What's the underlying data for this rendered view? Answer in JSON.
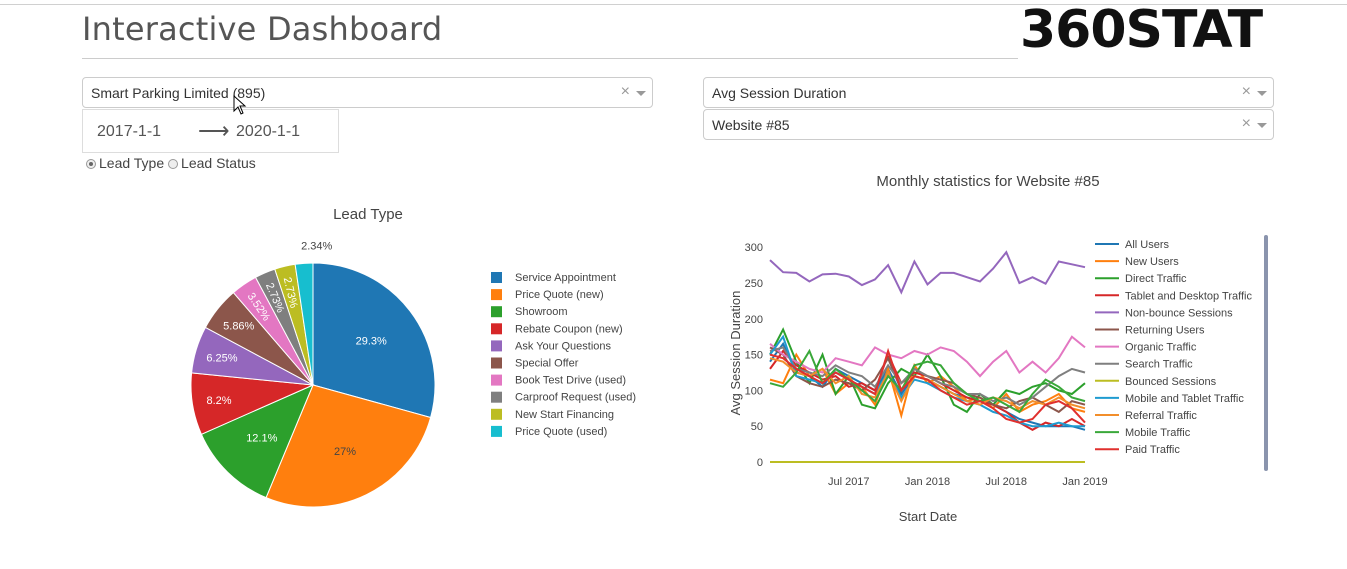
{
  "header": {
    "title": "Interactive Dashboard",
    "logo": "360STAT"
  },
  "filters": {
    "company": {
      "value": "Smart Parking Limited (895)",
      "clear": "×"
    },
    "date_range": {
      "start": "2017-1-1",
      "arrow": "⟶",
      "end": "2020-1-1"
    },
    "radio": [
      {
        "label": "Lead Type",
        "selected": true
      },
      {
        "label": "Lead Status",
        "selected": false
      }
    ],
    "metric": {
      "value": "Avg Session Duration",
      "clear": "×"
    },
    "website": {
      "value": "Website #85",
      "clear": "×"
    }
  },
  "chart_data": [
    {
      "type": "pie",
      "title": "Lead Type",
      "legend_position": "right",
      "slices": [
        {
          "label": "Service Appointment",
          "value": 29.3,
          "display": "29.3%",
          "color": "#1f77b4"
        },
        {
          "label": "Price Quote (new)",
          "value": 27,
          "display": "27%",
          "color": "#ff7f0e"
        },
        {
          "label": "Showroom",
          "value": 12.1,
          "display": "12.1%",
          "color": "#2ca02c"
        },
        {
          "label": "Rebate Coupon (new)",
          "value": 8.2,
          "display": "8.2%",
          "color": "#d62728"
        },
        {
          "label": "Ask Your Questions",
          "value": 6.25,
          "display": "6.25%",
          "color": "#9467bd"
        },
        {
          "label": "Special Offer",
          "value": 5.86,
          "display": "5.86%",
          "color": "#8c564b"
        },
        {
          "label": "Book Test Drive (used)",
          "value": 3.52,
          "display": "3.52%",
          "color": "#e377c2"
        },
        {
          "label": "Carproof Request (used)",
          "value": 2.73,
          "display": "2.73%",
          "color": "#7f7f7f"
        },
        {
          "label": "New Start Financing",
          "value": 2.73,
          "display": "2.73%",
          "color": "#bcbd22"
        },
        {
          "label": "Price Quote (used)",
          "value": 2.34,
          "display": "2.34%",
          "color": "#17becf"
        }
      ]
    },
    {
      "type": "line",
      "title": "Monthly statistics for Website #85",
      "xlabel": "Start Date",
      "ylabel": "Avg Session Duration",
      "ylim": [
        0,
        310
      ],
      "yticks": [
        "0",
        "50",
        "100",
        "150",
        "200",
        "250",
        "300"
      ],
      "xticks": [
        "Jul 2017",
        "Jan 2018",
        "Jul 2018",
        "Jan 2019"
      ],
      "x_start": "2017-01",
      "x_end": "2019-01",
      "grid": false,
      "legend_position": "right",
      "series": [
        {
          "name": "All Users",
          "color": "#1f77b4",
          "values": [
            140,
            165,
            125,
            120,
            105,
            130,
            120,
            110,
            100,
            130,
            95,
            120,
            115,
            105,
            95,
            90,
            85,
            80,
            70,
            60,
            55,
            50,
            50,
            50,
            45
          ]
        },
        {
          "name": "New Users",
          "color": "#ff7f0e",
          "values": [
            115,
            110,
            150,
            120,
            130,
            95,
            110,
            105,
            80,
            130,
            65,
            135,
            110,
            120,
            105,
            85,
            90,
            75,
            95,
            70,
            80,
            85,
            95,
            75,
            70
          ]
        },
        {
          "name": "Direct Traffic",
          "color": "#2ca02c",
          "values": [
            150,
            185,
            140,
            110,
            150,
            95,
            120,
            80,
            75,
            110,
            130,
            120,
            150,
            120,
            80,
            70,
            95,
            80,
            100,
            95,
            105,
            110,
            100,
            95,
            110
          ]
        },
        {
          "name": "Tablet and Desktop Traffic",
          "color": "#d62728",
          "values": [
            130,
            155,
            135,
            125,
            115,
            120,
            105,
            110,
            100,
            150,
            110,
            125,
            120,
            110,
            100,
            90,
            85,
            80,
            70,
            55,
            45,
            55,
            50,
            60,
            50
          ]
        },
        {
          "name": "Non-bounce Sessions",
          "color": "#9467bd",
          "values": [
            282,
            265,
            264,
            252,
            262,
            263,
            259,
            247,
            255,
            275,
            237,
            280,
            248,
            264,
            264,
            258,
            252,
            270,
            293,
            250,
            258,
            249,
            280,
            276,
            272
          ]
        },
        {
          "name": "Returning Users",
          "color": "#8c564b",
          "values": [
            160,
            150,
            120,
            110,
            105,
            115,
            110,
            100,
            115,
            145,
            100,
            130,
            120,
            115,
            110,
            95,
            90,
            80,
            75,
            85,
            90,
            80,
            70,
            85,
            80
          ]
        },
        {
          "name": "Organic Traffic",
          "color": "#e377c2",
          "values": [
            165,
            150,
            140,
            130,
            125,
            145,
            140,
            135,
            160,
            150,
            145,
            155,
            150,
            160,
            155,
            140,
            120,
            140,
            155,
            125,
            140,
            125,
            145,
            175,
            160
          ]
        },
        {
          "name": "Search Traffic",
          "color": "#7f7f7f",
          "values": [
            155,
            160,
            130,
            125,
            120,
            135,
            125,
            120,
            105,
            135,
            110,
            130,
            120,
            110,
            105,
            95,
            95,
            85,
            90,
            80,
            90,
            105,
            120,
            130,
            125
          ]
        },
        {
          "name": "Bounced Sessions",
          "color": "#bcbd22",
          "values": [
            0,
            0,
            0,
            0,
            0,
            0,
            0,
            0,
            0,
            0,
            0,
            0,
            0,
            0,
            0,
            0,
            0,
            0,
            0,
            0,
            0,
            0,
            0,
            0,
            0
          ]
        },
        {
          "name": "Mobile and Tablet Traffic",
          "color": "#1f9bd0",
          "values": [
            150,
            175,
            120,
            115,
            110,
            125,
            115,
            105,
            95,
            125,
            90,
            115,
            110,
            100,
            90,
            85,
            80,
            70,
            65,
            55,
            50,
            50,
            55,
            50,
            50
          ]
        },
        {
          "name": "Referral Traffic",
          "color": "#f28e2b",
          "values": [
            145,
            140,
            125,
            120,
            130,
            110,
            120,
            95,
            90,
            125,
            85,
            120,
            115,
            105,
            95,
            85,
            80,
            90,
            85,
            75,
            85,
            80,
            90,
            80,
            75
          ]
        },
        {
          "name": "Mobile Traffic",
          "color": "#3aa83a",
          "values": [
            110,
            105,
            125,
            155,
            110,
            130,
            115,
            100,
            85,
            120,
            100,
            135,
            140,
            135,
            110,
            95,
            85,
            90,
            80,
            70,
            95,
            115,
            105,
            90,
            85
          ]
        },
        {
          "name": "Paid Traffic",
          "color": "#e0302e",
          "values": [
            150,
            145,
            130,
            120,
            110,
            125,
            115,
            105,
            95,
            155,
            100,
            120,
            115,
            100,
            90,
            80,
            85,
            75,
            60,
            55,
            60,
            80,
            85,
            75,
            55
          ]
        }
      ]
    }
  ]
}
